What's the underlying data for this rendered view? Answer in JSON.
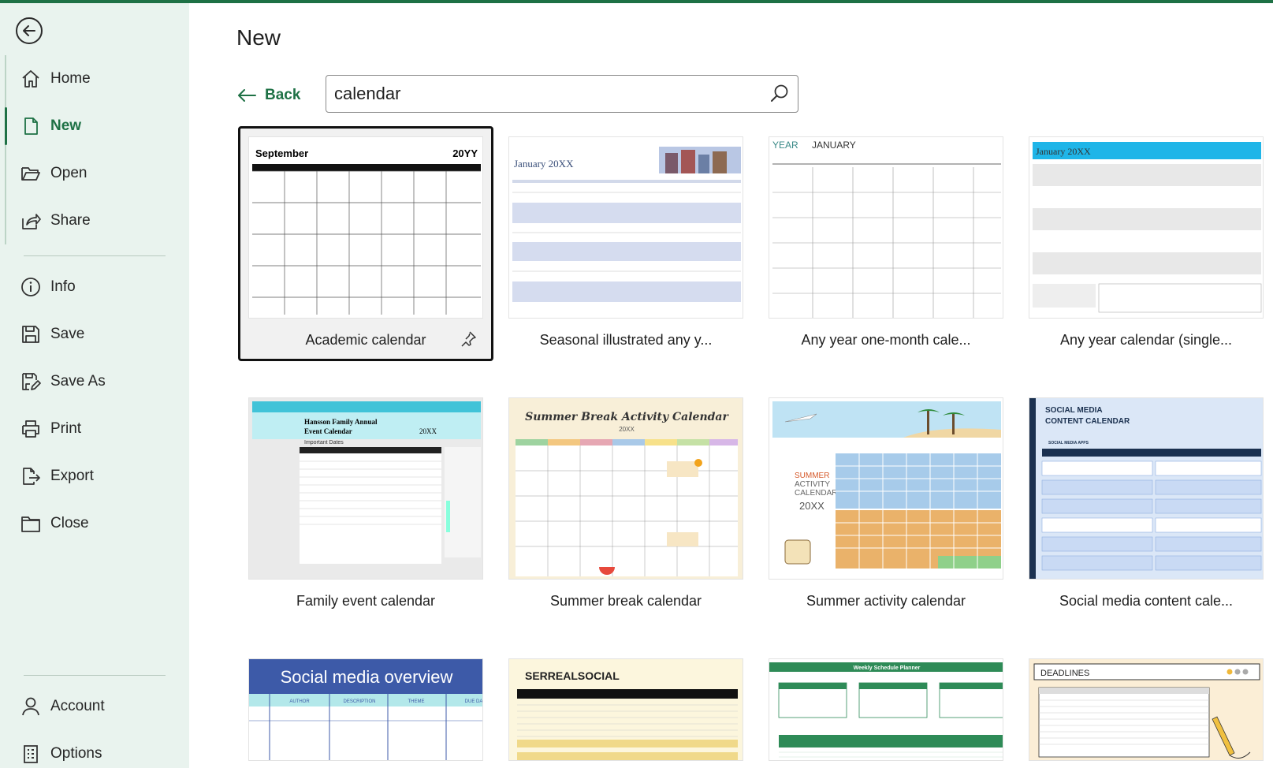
{
  "sidebar": {
    "items": [
      {
        "label": "Home",
        "icon": "home-icon"
      },
      {
        "label": "New",
        "icon": "new-document-icon"
      },
      {
        "label": "Open",
        "icon": "folder-open-icon"
      },
      {
        "label": "Share",
        "icon": "share-icon"
      },
      {
        "label": "Info",
        "icon": "info-icon"
      },
      {
        "label": "Save",
        "icon": "save-icon"
      },
      {
        "label": "Save As",
        "icon": "save-as-icon"
      },
      {
        "label": "Print",
        "icon": "print-icon"
      },
      {
        "label": "Export",
        "icon": "export-icon"
      },
      {
        "label": "Close",
        "icon": "close-folder-icon"
      },
      {
        "label": "Account",
        "icon": "account-icon"
      },
      {
        "label": "Options",
        "icon": "options-icon"
      }
    ],
    "active": "New"
  },
  "main": {
    "title": "New",
    "back_label": "Back",
    "search": {
      "value": "calendar"
    },
    "templates": [
      {
        "name": "Academic calendar",
        "selected": true
      },
      {
        "name": "Seasonal illustrated any y..."
      },
      {
        "name": "Any year one-month cale..."
      },
      {
        "name": "Any year calendar (single..."
      },
      {
        "name": "Family event calendar"
      },
      {
        "name": "Summer break calendar"
      },
      {
        "name": "Summer activity calendar"
      },
      {
        "name": "Social media content cale..."
      },
      {
        "name": ""
      },
      {
        "name": ""
      },
      {
        "name": ""
      },
      {
        "name": ""
      }
    ],
    "thumbs": {
      "academic": {
        "month": "September",
        "year": "20YY"
      },
      "seasonal": {
        "title": "January 20XX"
      },
      "oneMonth": {
        "year": "YEAR",
        "month": "JANUARY"
      },
      "anyYear": {
        "title": "January 20XX"
      },
      "family": {
        "title1": "Hansson Family Annual",
        "title2": "Event Calendar",
        "year": "20XX",
        "sub": "Important Dates"
      },
      "summerBreak": {
        "title": "Summer Break Activity Calendar",
        "year": "20XX"
      },
      "summerActivity": {
        "line1": "SUMMER",
        "line2": "ACTIVITY",
        "line3": "CALENDAR",
        "year": "20XX"
      },
      "socialContent": {
        "line1": "SOCIAL MEDIA",
        "line2": "CONTENT CALENDAR",
        "sub": "SOCIAL MEDIA APPS"
      },
      "socialOverview": {
        "title": "Social media overview",
        "cols": [
          "AUTHOR",
          "DESCRIPTION",
          "THEME",
          "DUE DA"
        ]
      },
      "serreal": {
        "title": "SERREALSOCIAL"
      },
      "weekly": {
        "title": "Weekly Schedule Planner"
      },
      "deadlines": {
        "title": "DEADLINES"
      }
    }
  },
  "colors": {
    "accent": "#1e7145",
    "sidebar_bg": "#e9f3ee"
  }
}
